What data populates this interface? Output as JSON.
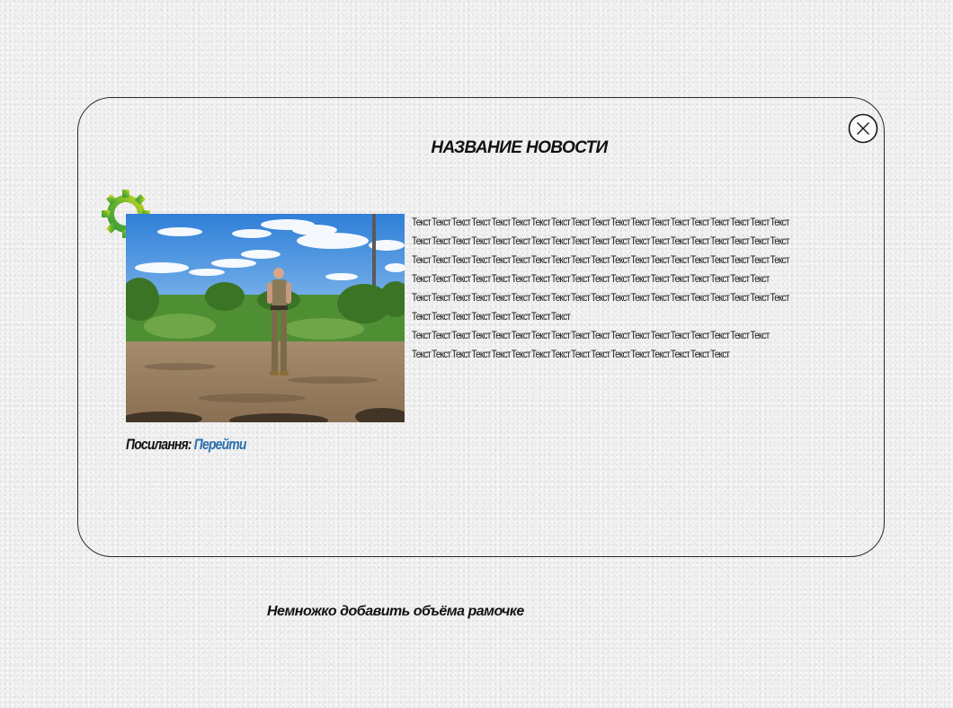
{
  "news": {
    "title": "НАЗВАНИЕ НОВОСТИ",
    "body_lines": [
      "Текст Текст Текст Текст Текст Текст Текст Текст Текст Текст Текст Текст Текст Текст Текст Текст Текст Текст Текст",
      "Текст Текст Текст Текст Текст Текст Текст Текст Текст Текст Текст Текст Текст Текст Текст Текст Текст Текст Текст",
      "Текст Текст Текст Текст Текст Текст Текст Текст Текст Текст Текст Текст Текст Текст Текст Текст Текст Текст Текст",
      "Текст Текст Текст Текст Текст Текст Текст Текст Текст Текст Текст Текст Текст Текст Текст Текст Текст Текст",
      "Текст Текст Текст Текст Текст Текст Текст Текст Текст Текст Текст Текст Текст Текст Текст Текст Текст Текст Текст",
      "Текст Текст Текст Текст Текст Текст Текст Текст",
      "Текст Текст Текст Текст Текст Текст Текст Текст Текст Текст Текст Текст Текст Текст Текст Текст Текст Текст",
      "Текст Текст Текст Текст Текст Текст Текст Текст Текст Текст Текст Текст Текст Текст Текст Текст"
    ],
    "link_label": "Посилання:",
    "link_text": "Перейти"
  },
  "note": "Немножко добавить объёма рамочке",
  "icons": {
    "close": "close-circle-icon",
    "logo": "gear-logo-icon"
  },
  "colors": {
    "link": "#2a6fb0",
    "gear_green": "#3aa63a",
    "gear_yellow": "#d6d61e",
    "border": "#2b2b2b",
    "background": "#f1f1f1"
  }
}
